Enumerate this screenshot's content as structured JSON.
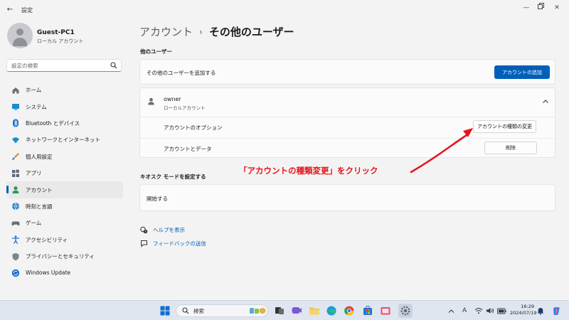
{
  "window": {
    "title": "設定"
  },
  "profile": {
    "name": "Guest-PC1",
    "type": "ローカル アカウント"
  },
  "search": {
    "placeholder": "設定の検索"
  },
  "nav": {
    "items": [
      {
        "label": "ホーム",
        "icon": "home-icon"
      },
      {
        "label": "システム",
        "icon": "system-icon"
      },
      {
        "label": "Bluetooth とデバイス",
        "icon": "bluetooth-icon"
      },
      {
        "label": "ネットワークとインターネット",
        "icon": "wifi-icon"
      },
      {
        "label": "個人用設定",
        "icon": "brush-icon"
      },
      {
        "label": "アプリ",
        "icon": "apps-icon"
      },
      {
        "label": "アカウント",
        "icon": "account-icon",
        "active": true
      },
      {
        "label": "時刻と言語",
        "icon": "globe-clock-icon"
      },
      {
        "label": "ゲーム",
        "icon": "gamepad-icon"
      },
      {
        "label": "アクセシビリティ",
        "icon": "accessibility-icon"
      },
      {
        "label": "プライバシーとセキュリティ",
        "icon": "shield-icon"
      },
      {
        "label": "Windows Update",
        "icon": "update-icon"
      }
    ]
  },
  "breadcrumb": {
    "parent": "アカウント",
    "separator": "›",
    "current": "その他のユーザー"
  },
  "other_users": {
    "section_label": "他のユーザー",
    "add_text": "その他のユーザーを追加する",
    "add_button": "アカウントの追加",
    "user": {
      "name": "owner",
      "type": "ローカルアカウント",
      "options_label": "アカウントのオプション",
      "change_type_button": "アカウントの種類の変更",
      "data_label": "アカウントとデータ",
      "delete_button": "削除"
    }
  },
  "kiosk": {
    "section_label": "キオスク モードを設定する",
    "start_text": "開始する"
  },
  "links": {
    "help": "ヘルプを表示",
    "feedback": "フィードバックの送信"
  },
  "annotation": {
    "text": "「アカウントの種類変更」をクリック",
    "color": "#e8131c"
  },
  "taskbar": {
    "search_placeholder": "検索",
    "ime": "A",
    "time": "16:29",
    "date": "2024/07/19"
  },
  "colors": {
    "accent": "#005fb8",
    "background": "#f3f3f3",
    "card": "#fbfbfb"
  }
}
